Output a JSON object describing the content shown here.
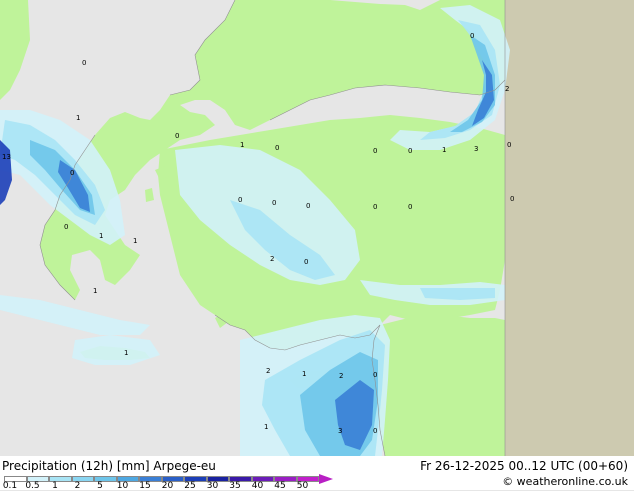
{
  "map": {
    "colors": {
      "sea": "#e6e6e6",
      "land_forecast": "#bff39a",
      "land_outside": "#cdcab0",
      "precip_light": "#d2f2fa",
      "precip_mid": "#a8e4f5",
      "precip_heavy": "#6ec5ea",
      "precip_strong": "#3a7fd6",
      "precip_max": "#1c3fb8",
      "coast": "#909090"
    },
    "labels": [
      {
        "id": "n1",
        "text": "0"
      },
      {
        "id": "n2",
        "text": "0"
      },
      {
        "id": "n3",
        "text": "2"
      },
      {
        "id": "n4",
        "text": "1"
      },
      {
        "id": "n5",
        "text": "0"
      },
      {
        "id": "n6",
        "text": "1"
      },
      {
        "id": "n7",
        "text": "0"
      },
      {
        "id": "n8",
        "text": "0"
      },
      {
        "id": "n9",
        "text": "0"
      },
      {
        "id": "n10",
        "text": "1"
      },
      {
        "id": "n11",
        "text": "3"
      },
      {
        "id": "n12",
        "text": "0"
      },
      {
        "id": "n13",
        "text": "13"
      },
      {
        "id": "n14",
        "text": "0"
      },
      {
        "id": "n15",
        "text": "0"
      },
      {
        "id": "n16",
        "text": "0"
      },
      {
        "id": "n17",
        "text": "0"
      },
      {
        "id": "n18",
        "text": "0"
      },
      {
        "id": "n19",
        "text": "0"
      },
      {
        "id": "n20",
        "text": "0"
      },
      {
        "id": "n21",
        "text": "0"
      },
      {
        "id": "n22",
        "text": "1"
      },
      {
        "id": "n23",
        "text": "1"
      },
      {
        "id": "n24",
        "text": "2"
      },
      {
        "id": "n25",
        "text": "0"
      },
      {
        "id": "n26",
        "text": "1"
      },
      {
        "id": "n27",
        "text": "1"
      },
      {
        "id": "n28",
        "text": "2"
      },
      {
        "id": "n29",
        "text": "1"
      },
      {
        "id": "n30",
        "text": "2"
      },
      {
        "id": "n31",
        "text": "0"
      },
      {
        "id": "n32",
        "text": "1"
      },
      {
        "id": "n33",
        "text": "3"
      },
      {
        "id": "n34",
        "text": "0"
      },
      {
        "id": "n35",
        "text": "0"
      },
      {
        "id": "n36",
        "text": "0"
      }
    ]
  },
  "footer": {
    "title": "Precipitation (12h) [mm] Arpege-eu",
    "datetime": "Fr 26-12-2025 00..12 UTC (00+60)",
    "credit": "© weatheronline.co.uk"
  },
  "legend": {
    "ticks": [
      "0.1",
      "0.5",
      "1",
      "2",
      "5",
      "10",
      "15",
      "20",
      "25",
      "30",
      "35",
      "40",
      "45",
      "50"
    ],
    "colors": [
      "#ffffff",
      "#d2f2fa",
      "#a8e4f5",
      "#8ad6f2",
      "#6ec5ea",
      "#4ea8e2",
      "#3a7fd6",
      "#2a5fc8",
      "#1c3fb8",
      "#1a22a0",
      "#3a1aa8",
      "#6b1cb8",
      "#9a1ec4",
      "#c21fcc"
    ]
  }
}
